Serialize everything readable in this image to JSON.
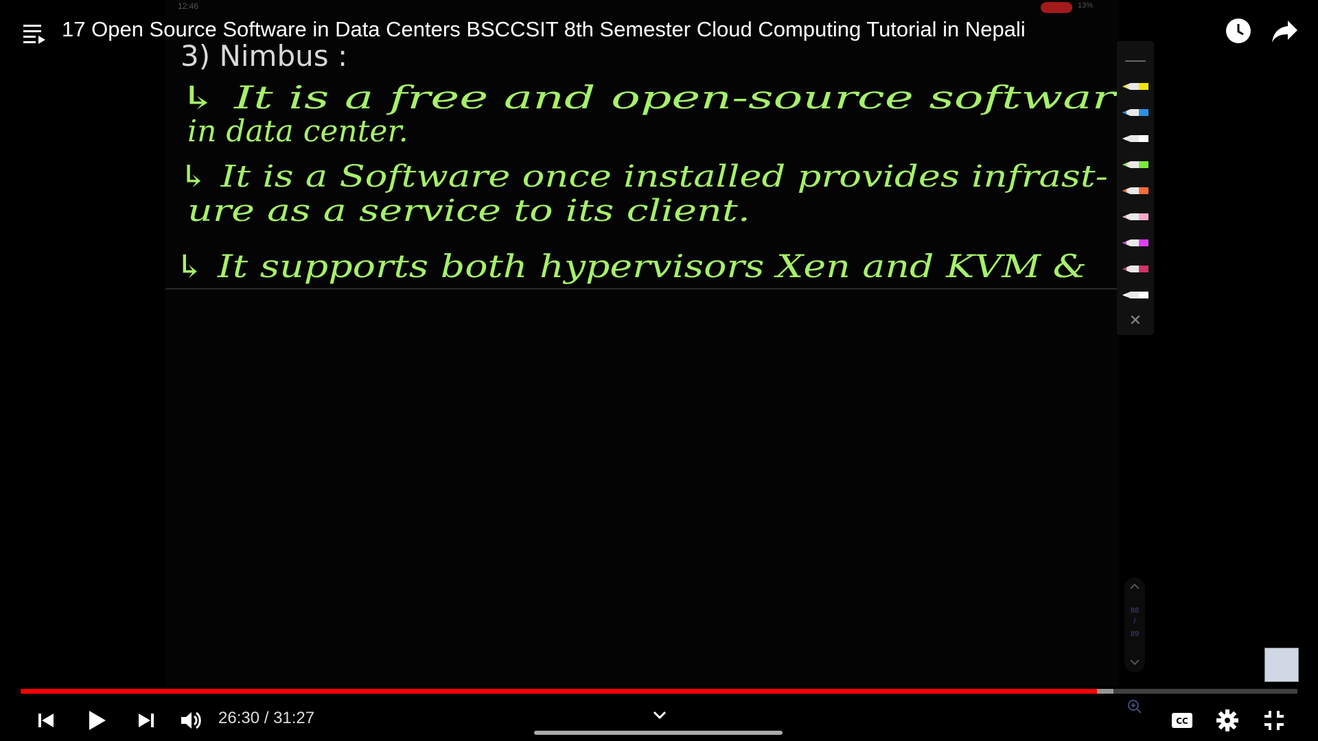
{
  "window": {
    "title": "17 Open Source Software in Data Centers BSCCSIT 8th Semester Cloud Computing Tutorial in Nepali"
  },
  "slide": {
    "status_time": "12:46",
    "status_battery": "13%",
    "heading": "3) Nimbus :",
    "lines": [
      "↳ It is a free and open-source software used",
      "in data center.",
      "↳ It is a Software once installed provides infrast-",
      "ure as a service to its client.",
      "↳ It supports both hypervisors Xen and KVM &"
    ],
    "pen_colors": [
      "#f2e600",
      "#2d8fe6",
      "#ffffff",
      "#7ee83a",
      "#ff6a3d",
      "#f6a7c8",
      "#e040fb",
      "#d1346b",
      "#ffffff"
    ],
    "page_nav": {
      "current": "88",
      "total": "89"
    }
  },
  "player": {
    "current_time": "26:30",
    "duration": "31:27",
    "time_display": "26:30 / 31:27",
    "progress": 0.843,
    "buffered": 0.856,
    "colors": {
      "played": "#ff0000"
    }
  },
  "icons": {
    "menu": "playlist-menu-icon",
    "watch_later": "clock-icon",
    "share": "share-icon",
    "prev": "skip-previous-icon",
    "play": "play-icon",
    "next": "skip-next-icon",
    "volume": "volume-icon",
    "expand": "chevron-down-icon",
    "captions": "closed-captions-icon",
    "settings": "gear-icon",
    "exit_fullscreen": "exit-fullscreen-icon"
  }
}
